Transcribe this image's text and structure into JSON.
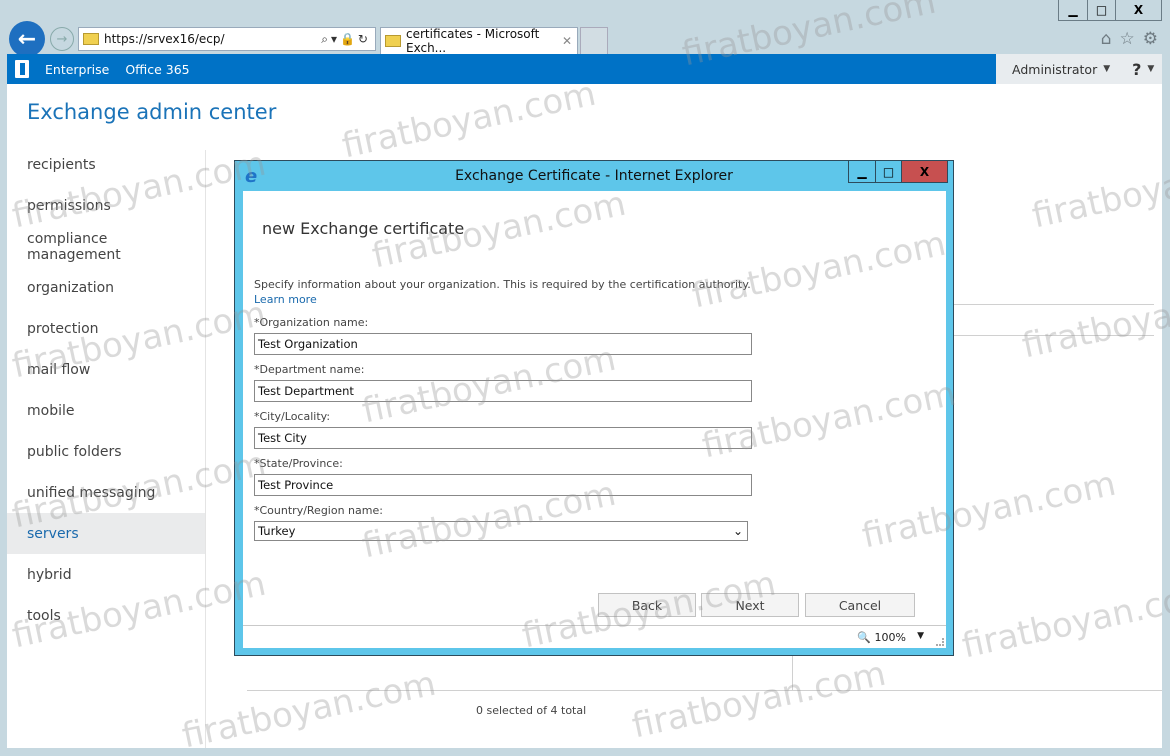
{
  "browser": {
    "url": "https://srvex16/ecp/",
    "tab_title": "certificates - Microsoft Exch...",
    "window_controls": [
      "minimize-icon",
      "maximize-icon",
      "close-icon"
    ],
    "toolbar_icons": [
      "home-icon",
      "favorites-star-icon",
      "settings-gear-icon"
    ]
  },
  "o365_bar": {
    "links": [
      "Enterprise",
      "Office 365"
    ],
    "user": "Administrator",
    "help": "?"
  },
  "app": {
    "title": "Exchange admin center",
    "nav": [
      {
        "label": "recipients",
        "active": false
      },
      {
        "label": "permissions",
        "active": false
      },
      {
        "label": "compliance management",
        "active": false
      },
      {
        "label": "organization",
        "active": false
      },
      {
        "label": "protection",
        "active": false
      },
      {
        "label": "mail flow",
        "active": false
      },
      {
        "label": "mobile",
        "active": false
      },
      {
        "label": "public folders",
        "active": false
      },
      {
        "label": "unified messaging",
        "active": false
      },
      {
        "label": "servers",
        "active": true
      },
      {
        "label": "hybrid",
        "active": false
      },
      {
        "label": "tools",
        "active": false
      }
    ],
    "status": "0 selected of 4 total"
  },
  "dialog": {
    "window_title": "Exchange Certificate - Internet Explorer",
    "heading": "new Exchange certificate",
    "description": "Specify information about your organization. This is required by the certification authority.",
    "learn_more": "Learn more",
    "fields": {
      "org": {
        "label": "*Organization name:",
        "value": "Test Organization"
      },
      "dept": {
        "label": "*Department name:",
        "value": "Test Department"
      },
      "city": {
        "label": "*City/Locality:",
        "value": "Test City"
      },
      "state": {
        "label": "*State/Province:",
        "value": "Test Province"
      },
      "country": {
        "label": "*Country/Region name:",
        "value": "Turkey"
      }
    },
    "buttons": {
      "back": "Back",
      "next": "Next",
      "cancel": "Cancel"
    },
    "zoom_level": "100%"
  },
  "watermark": "firatboyan.com",
  "colors": {
    "accent": "#0072c6",
    "popup_frame": "#5ec6ea",
    "close_red": "#c75050",
    "link": "#1a6aad"
  }
}
